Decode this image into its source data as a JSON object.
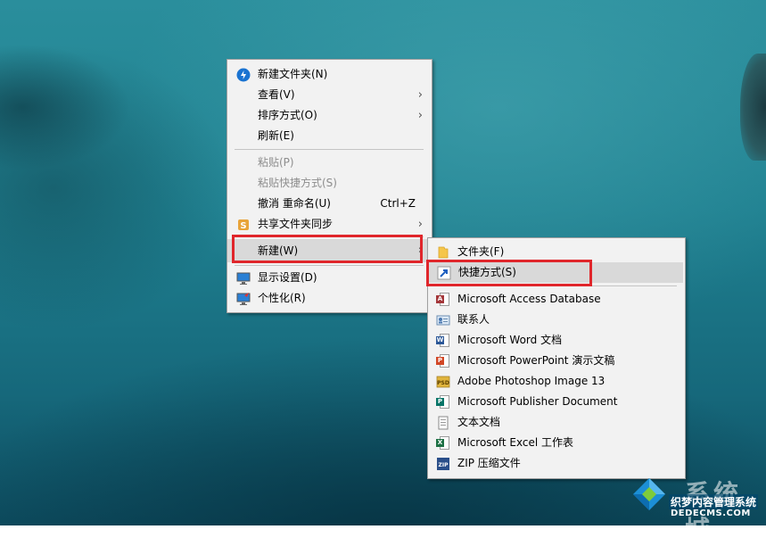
{
  "main_menu": {
    "items": [
      {
        "label": "新建文件夹(N)",
        "icon": "new-folder-icon"
      },
      {
        "label": "查看(V)",
        "submenu": true
      },
      {
        "label": "排序方式(O)",
        "submenu": true
      },
      {
        "label": "刷新(E)"
      },
      {
        "label": "粘贴(P)",
        "disabled": true
      },
      {
        "label": "粘贴快捷方式(S)",
        "disabled": true
      },
      {
        "label": "撤消 重命名(U)",
        "accel": "Ctrl+Z"
      },
      {
        "label": "共享文件夹同步",
        "icon": "share-sync-icon",
        "submenu": true
      },
      {
        "label": "新建(W)",
        "submenu": true,
        "highlighted": true
      },
      {
        "label": "显示设置(D)",
        "icon": "display-settings-icon"
      },
      {
        "label": "个性化(R)",
        "icon": "personalize-icon"
      }
    ]
  },
  "new_submenu": {
    "items": [
      {
        "label": "文件夹(F)",
        "icon": "folder-icon"
      },
      {
        "label": "快捷方式(S)",
        "icon": "shortcut-icon",
        "highlighted": true
      },
      {
        "label": "Microsoft Access Database",
        "icon": "access-icon"
      },
      {
        "label": "联系人",
        "icon": "contact-icon"
      },
      {
        "label": "Microsoft Word 文档",
        "icon": "word-icon"
      },
      {
        "label": "Microsoft PowerPoint 演示文稿",
        "icon": "powerpoint-icon"
      },
      {
        "label": "Adobe Photoshop Image 13",
        "icon": "photoshop-icon"
      },
      {
        "label": "Microsoft Publisher Document",
        "icon": "publisher-icon"
      },
      {
        "label": "文本文档",
        "icon": "text-document-icon"
      },
      {
        "label": "Microsoft Excel 工作表",
        "icon": "excel-icon"
      },
      {
        "label": "ZIP 压缩文件",
        "icon": "zip-icon"
      }
    ]
  },
  "arrow_glyph": "›",
  "watermark": {
    "brand": "系统城",
    "slogan": "织梦内容管理系统",
    "url": "DEDECMS.COM"
  },
  "colors": {
    "menu_bg": "#f2f2f2",
    "highlight_bg": "#d9d9d9",
    "annotation_red": "#e0262b",
    "disabled_text": "#8d8d8d"
  }
}
